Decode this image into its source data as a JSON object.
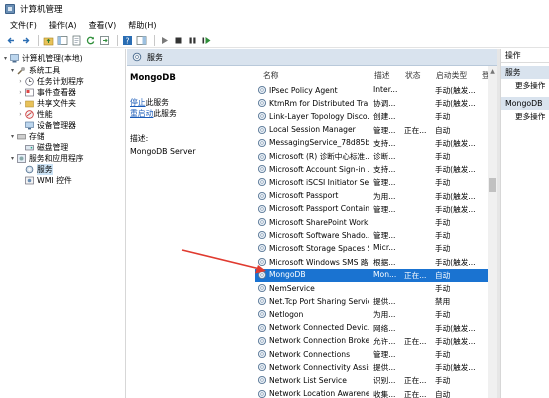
{
  "window": {
    "title": "计算机管理"
  },
  "menu": [
    "文件(F)",
    "操作(A)",
    "查看(V)",
    "帮助(H)"
  ],
  "tree": {
    "root": "计算机管理(本地)",
    "system_tools": "系统工具",
    "task_scheduler": "任务计划程序",
    "event_viewer": "事件查看器",
    "shared_folders": "共享文件夹",
    "performance": "性能",
    "device_manager": "设备管理器",
    "storage": "存储",
    "disk_management": "磁盘管理",
    "services_apps": "服务和应用程序",
    "services": "服务",
    "wmi": "WMI 控件"
  },
  "pane_header": "服务",
  "detail": {
    "service_name": "MongoDB",
    "stop_link": "停止",
    "stop_suffix": "此服务",
    "restart_link": "重启动",
    "restart_suffix": "此服务",
    "desc_label": "描述:",
    "desc_value": "MongoDB Server"
  },
  "columns": [
    "名称",
    "描述",
    "状态",
    "启动类型",
    "登"
  ],
  "rows": [
    {
      "name": "IPsec Policy Agent",
      "desc": "Inter...",
      "status": "",
      "startup": "手动(触发..."
    },
    {
      "name": "KtmRm for Distributed Tra...",
      "desc": "协调...",
      "status": "",
      "startup": "手动(触发..."
    },
    {
      "name": "Link-Layer Topology Disco...",
      "desc": "创建...",
      "status": "",
      "startup": "手动"
    },
    {
      "name": "Local Session Manager",
      "desc": "管理...",
      "status": "正在...",
      "startup": "自动"
    },
    {
      "name": "MessagingService_78d85be",
      "desc": "支持...",
      "status": "",
      "startup": "手动(触发..."
    },
    {
      "name": "Microsoft (R) 诊断中心标准...",
      "desc": "诊断...",
      "status": "",
      "startup": "手动"
    },
    {
      "name": "Microsoft Account Sign-in ...",
      "desc": "支持...",
      "status": "",
      "startup": "手动(触发..."
    },
    {
      "name": "Microsoft iSCSI Initiator Ser...",
      "desc": "管理...",
      "status": "",
      "startup": "手动"
    },
    {
      "name": "Microsoft Passport",
      "desc": "为用...",
      "status": "",
      "startup": "手动(触发..."
    },
    {
      "name": "Microsoft Passport Container",
      "desc": "管理...",
      "status": "",
      "startup": "手动(触发..."
    },
    {
      "name": "Microsoft SharePoint Work...",
      "desc": "",
      "status": "",
      "startup": "手动"
    },
    {
      "name": "Microsoft Software Shado...",
      "desc": "管理...",
      "status": "",
      "startup": "手动"
    },
    {
      "name": "Microsoft Storage Spaces S...",
      "desc": "Micr...",
      "status": "",
      "startup": "手动"
    },
    {
      "name": "Microsoft Windows SMS 路...",
      "desc": "根据...",
      "status": "",
      "startup": "手动(触发..."
    },
    {
      "name": "MongoDB",
      "desc": "Mon...",
      "status": "正在...",
      "startup": "自动"
    },
    {
      "name": "NemService",
      "desc": "",
      "status": "",
      "startup": "手动"
    },
    {
      "name": "Net.Tcp Port Sharing Service",
      "desc": "提供...",
      "status": "",
      "startup": "禁用"
    },
    {
      "name": "Netlogon",
      "desc": "为用...",
      "status": "",
      "startup": "手动"
    },
    {
      "name": "Network Connected Devic...",
      "desc": "网络...",
      "status": "",
      "startup": "手动(触发..."
    },
    {
      "name": "Network Connection Broker",
      "desc": "允许...",
      "status": "正在...",
      "startup": "手动(触发..."
    },
    {
      "name": "Network Connections",
      "desc": "管理...",
      "status": "",
      "startup": "手动"
    },
    {
      "name": "Network Connectivity Assis...",
      "desc": "提供...",
      "status": "",
      "startup": "手动(触发..."
    },
    {
      "name": "Network List Service",
      "desc": "识别...",
      "status": "正在...",
      "startup": "手动"
    },
    {
      "name": "Network Location Awarene...",
      "desc": "收集...",
      "status": "正在...",
      "startup": "自动"
    }
  ],
  "selected_row": 14,
  "actions": {
    "header": "操作",
    "section1": "服务",
    "more1": "更多操作",
    "section2": "MongoDB",
    "more2": "更多操作"
  },
  "colors": {
    "selection": "#1a73d1",
    "pane_header": "#d9e3ee",
    "arrow": "#e03a2f"
  }
}
